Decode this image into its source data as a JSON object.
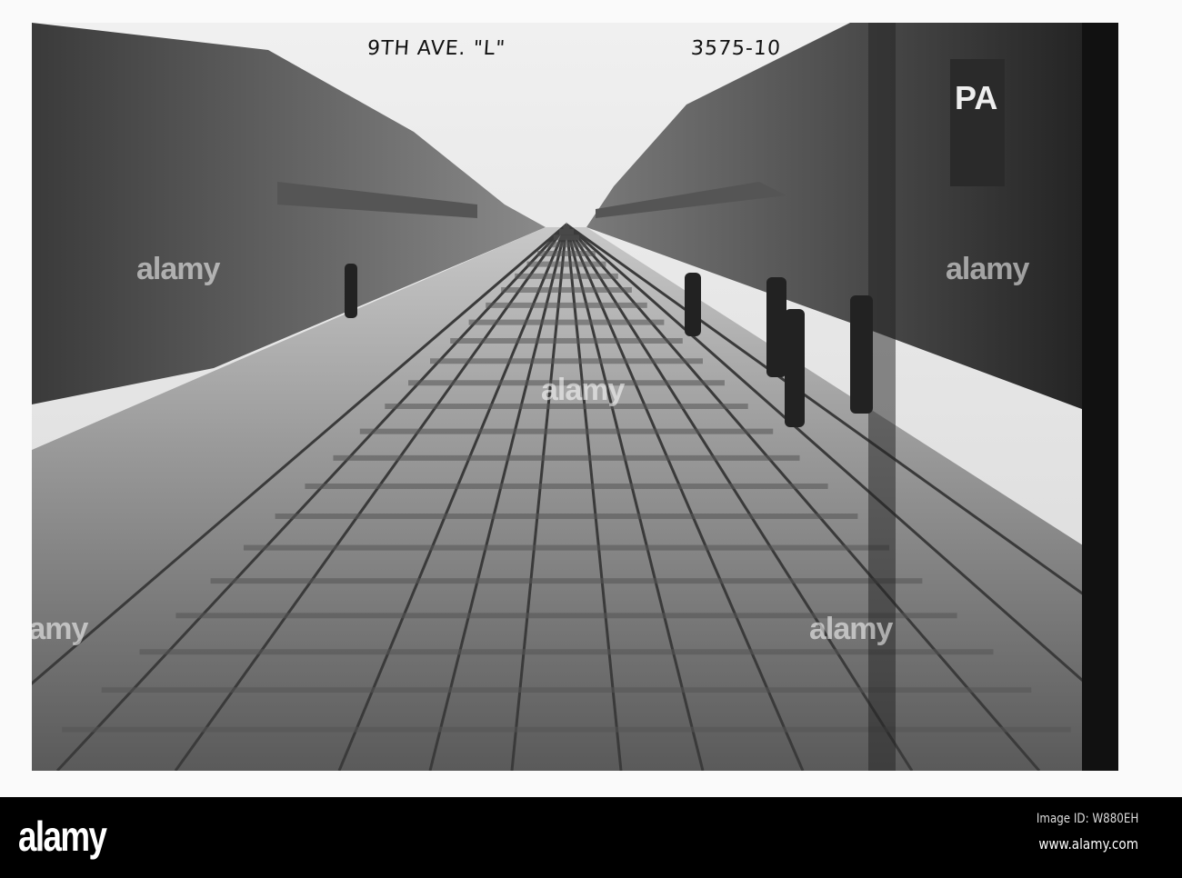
{
  "photo": {
    "caption_left": "9TH AVE. \"L\"",
    "caption_right": "3575-10",
    "sign_text": "PA"
  },
  "watermark": {
    "text": "alamy"
  },
  "footer": {
    "logo": "alamy",
    "image_id": "Image ID: W880EH",
    "url": "www.alamy.com"
  }
}
